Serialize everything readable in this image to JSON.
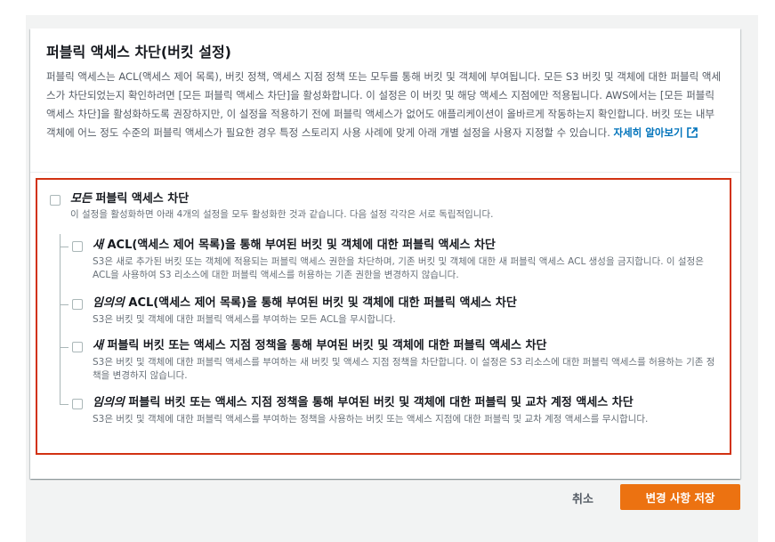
{
  "panel": {
    "title": "퍼블릭 액세스 차단(버킷 설정)",
    "description": "퍼블릭 액세스는 ACL(액세스 제어 목록), 버킷 정책, 액세스 지점 정책 또는 모두를 통해 버킷 및 객체에 부여됩니다. 모든 S3 버킷 및 객체에 대한 퍼블릭 액세스가 차단되었는지 확인하려면 [모든 퍼블릭 액세스 차단]을 활성화합니다. 이 설정은 이 버킷 및 해당 액세스 지점에만 적용됩니다. AWS에서는 [모든 퍼블릭 액세스 차단]을 활성화하도록 권장하지만, 이 설정을 적용하기 전에 퍼블릭 액세스가 없어도 애플리케이션이 올바르게 작동하는지 확인합니다. 버킷 또는 내부 객체에 어느 정도 수준의 퍼블릭 액세스가 필요한 경우 특정 스토리지 사용 사례에 맞게 아래 개별 설정을 사용자 지정할 수 있습니다.",
    "learn_more": "자세히 알아보기",
    "accent_link": "#0073bb"
  },
  "options": {
    "all": {
      "title_em": "모든",
      "title_rest": " 퍼블릭 액세스 차단",
      "desc": "이 설정을 활성화하면 아래 4개의 설정을 모두 활성화한 것과 같습니다. 다음 설정 각각은 서로 독립적입니다.",
      "checked": false
    },
    "items": [
      {
        "title_em": "새",
        "title_rest": " ACL(액세스 제어 목록)을 통해 부여된 버킷 및 객체에 대한 퍼블릭 액세스 차단",
        "desc": "S3은 새로 추가된 버킷 또는 객체에 적용되는 퍼블릭 액세스 권한을 차단하며, 기존 버킷 및 객체에 대한 새 퍼블릭 액세스 ACL 생성을 금지합니다. 이 설정은 ACL을 사용하여 S3 리소스에 대한 퍼블릭 액세스를 허용하는 기존 권한을 변경하지 않습니다.",
        "checked": false
      },
      {
        "title_em": "임의의",
        "title_rest": " ACL(액세스 제어 목록)을 통해 부여된 버킷 및 객체에 대한 퍼블릭 액세스 차단",
        "desc": "S3은 버킷 및 객체에 대한 퍼블릭 액세스를 부여하는 모든 ACL을 무시합니다.",
        "checked": false
      },
      {
        "title_em": "새",
        "title_rest": " 퍼블릭 버킷 또는 액세스 지점 정책을 통해 부여된 버킷 및 객체에 대한 퍼블릭 액세스 차단",
        "desc": "S3은 버킷 및 객체에 대한 퍼블릭 액세스를 부여하는 새 버킷 및 액세스 지점 정책을 차단합니다. 이 설정은 S3 리소스에 대한 퍼블릭 액세스를 허용하는 기존 정책을 변경하지 않습니다.",
        "checked": false
      },
      {
        "title_em": "임의의",
        "title_rest": " 퍼블릭 버킷 또는 액세스 지점 정책을 통해 부여된 버킷 및 객체에 대한 퍼블릭 및 교차 계정 액세스 차단",
        "desc": "S3은 버킷 및 객체에 대한 퍼블릭 액세스를 부여하는 정책을 사용하는 버킷 또는 액세스 지점에 대한 퍼블릭 및 교차 계정 액세스를 무시합니다.",
        "checked": false
      }
    ]
  },
  "footer": {
    "cancel_label": "취소",
    "save_label": "변경 사항 저장",
    "save_color": "#ec7211"
  },
  "highlight_color": "#d13212"
}
